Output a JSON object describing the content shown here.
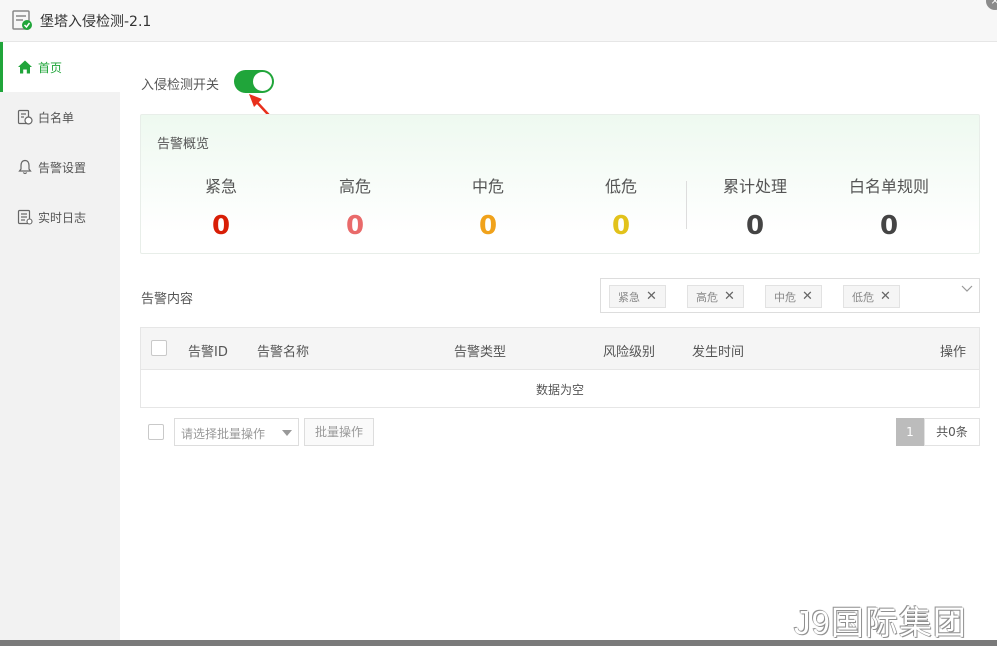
{
  "window": {
    "title": "堡塔入侵检测-2.1",
    "close_glyph": "×"
  },
  "sidebar": {
    "items": [
      {
        "label": "首页",
        "icon": "home-icon",
        "active": true
      },
      {
        "label": "白名单",
        "icon": "whitelist-icon",
        "active": false
      },
      {
        "label": "告警设置",
        "icon": "bell-icon",
        "active": false
      },
      {
        "label": "实时日志",
        "icon": "log-icon",
        "active": false
      }
    ]
  },
  "main": {
    "switch": {
      "label": "入侵检测开关",
      "on": true
    },
    "overview": {
      "title": "告警概览",
      "stats": [
        {
          "label": "紧急",
          "value": "0",
          "color": "#d81e06"
        },
        {
          "label": "高危",
          "value": "0",
          "color": "#e96a6a"
        },
        {
          "label": "中危",
          "value": "0",
          "color": "#f0a21b"
        },
        {
          "label": "低危",
          "value": "0",
          "color": "#e2c21b"
        },
        {
          "label": "累计处理",
          "value": "0",
          "color": "#444444"
        },
        {
          "label": "白名单规则",
          "value": "0",
          "color": "#444444"
        }
      ]
    },
    "alerts": {
      "title": "告警内容",
      "filter_tags": [
        "紧急",
        "高危",
        "中危",
        "低危"
      ],
      "columns": [
        "告警ID",
        "告警名称",
        "告警类型",
        "风险级别",
        "发生时间",
        "操作"
      ],
      "empty_text": "数据为空"
    },
    "footer": {
      "batch_placeholder": "请选择批量操作",
      "batch_button": "批量操作",
      "current_page": "1",
      "total": "共0条"
    }
  },
  "watermark": "J9国际集团",
  "colors": {
    "accent": "#20a53a",
    "annotation_arrow": "#e8301c"
  }
}
